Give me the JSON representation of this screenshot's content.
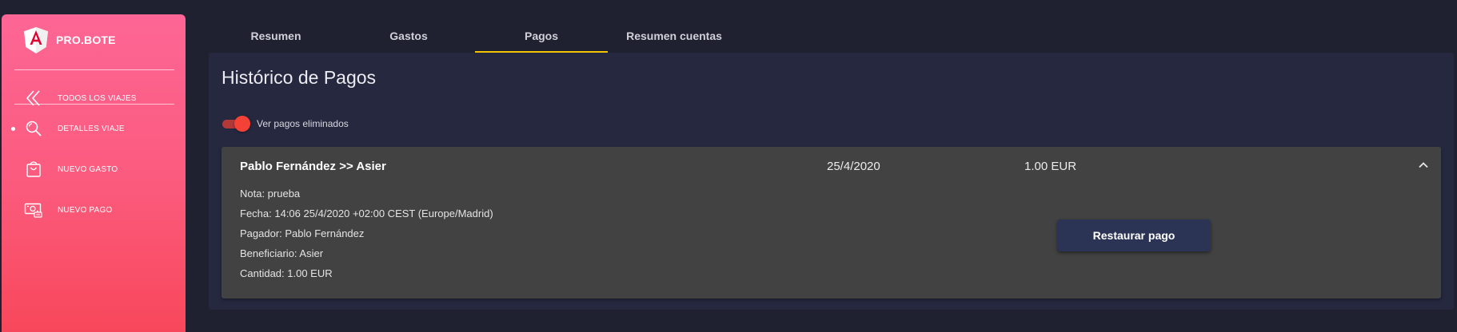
{
  "sidebar": {
    "brand": {
      "name": "PRO.BOTE",
      "icon": "angular-logo-icon"
    },
    "items": [
      {
        "label": "TODOS LOS VIAJES",
        "icon": "double-chevron-left-icon",
        "active": false
      },
      {
        "label": "DETALLES VIAJE",
        "icon": "search-icon",
        "active": true
      },
      {
        "label": "NUEVO GASTO",
        "icon": "shopping-bag-icon",
        "active": false
      },
      {
        "label": "NUEVO PAGO",
        "icon": "money-icon",
        "active": false
      }
    ]
  },
  "tabs": [
    {
      "label": "Resumen",
      "active": false
    },
    {
      "label": "Gastos",
      "active": false
    },
    {
      "label": "Pagos",
      "active": true
    },
    {
      "label": "Resumen cuentas",
      "active": false
    }
  ],
  "main": {
    "title": "Histórico de Pagos",
    "toggle": {
      "label": "Ver pagos eliminados",
      "on": true
    },
    "payment": {
      "title": "Pablo Fernández >> Asier",
      "date": "25/4/2020",
      "amount": "1.00 EUR",
      "expanded": true,
      "details": [
        "Nota: prueba",
        "Fecha: 14:06 25/4/2020 +02:00 CEST (Europe/Madrid)",
        "Pagador: Pablo Fernández",
        "Beneficiario: Asier",
        "Cantidad: 1.00 EUR"
      ],
      "action_label": "Restaurar pago"
    }
  },
  "colors": {
    "accent_tab": "#f5c400",
    "sidebar_top": "#fd6695",
    "sidebar_bottom": "#f8475a",
    "toggle_on": "#f44336",
    "button_bg": "#2b3454"
  }
}
